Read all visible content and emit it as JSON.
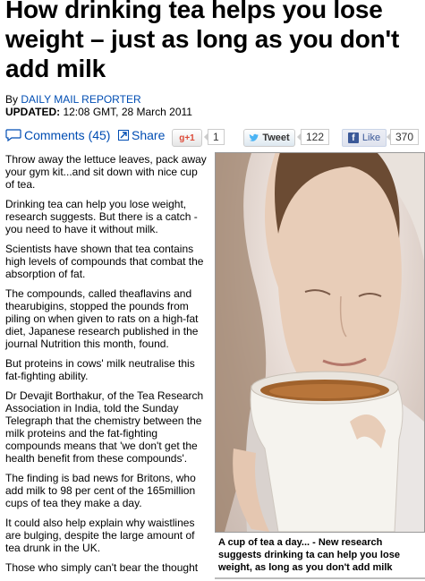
{
  "article": {
    "headline": "How drinking tea helps you lose weight – just as long as you don't add milk",
    "byline_prefix": "By",
    "author": "DAILY MAIL REPORTER",
    "updated_label": "UPDATED:",
    "updated_time": "12:08 GMT, 28 March 2011"
  },
  "social": {
    "comments_label": "Comments (45)",
    "share_label": "Share",
    "gplus_label": "+1",
    "gplus_count": "1",
    "tweet_label": "Tweet",
    "tweet_count": "122",
    "like_label": "Like",
    "like_count": "370",
    "colors": {
      "link": "#004db3",
      "facebook": "#3b5998",
      "gplus": "#dd4b39"
    }
  },
  "paragraphs": [
    "Throw away the lettuce leaves, pack away your gym kit...and sit down with nice cup of tea.",
    "Drinking tea can help you lose weight, research suggests. But there is a catch - you need to have it without milk.",
    "Scientists have shown that tea contains high levels of compounds that combat the absorption of fat.",
    "The compounds, called theaflavins and thearubigins, stopped the pounds from piling on when given to rats on a high-fat diet, Japanese research published in the journal Nutrition this month, found.",
    "But proteins in cows' milk neutralise this fat-fighting ability.",
    "Dr Devajit Borthakur, of the Tea Research Association in India, told the Sunday Telegraph that the chemistry between the milk proteins and the fat-fighting compounds means that 'we don't get the health benefit from these compounds'.",
    "The finding is bad news for Britons, who add milk to 98 per cent of the 165million cups of tea they make a day.",
    "It could also help explain why waistlines are bulging, despite the large amount of tea drunk in the UK.",
    "Those who simply can't bear the thought"
  ],
  "figure": {
    "caption": "A cup of tea a day... - New research suggests drinking ta can help you lose weight, as long as you don't add milk"
  }
}
